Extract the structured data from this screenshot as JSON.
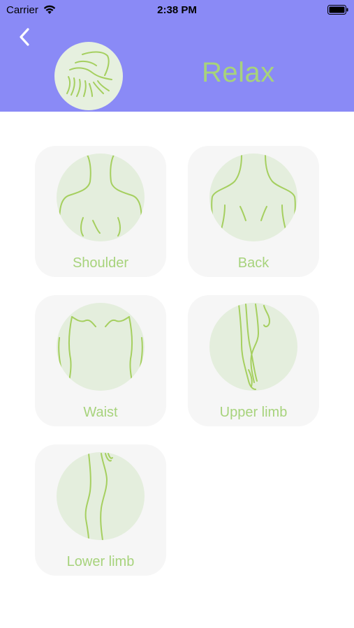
{
  "status_bar": {
    "carrier": "Carrier",
    "time": "2:38 PM"
  },
  "header": {
    "title": "Relax",
    "back_icon": "chevron-left-icon",
    "avatar_icon": "hands-massage-icon",
    "background_color": "#8a8af6",
    "title_color": "#a7d37c"
  },
  "body_parts": [
    {
      "label": "Shoulder",
      "icon": "shoulder-icon"
    },
    {
      "label": "Back",
      "icon": "back-icon"
    },
    {
      "label": "Waist",
      "icon": "waist-icon"
    },
    {
      "label": "Upper limb",
      "icon": "upper-limb-icon"
    },
    {
      "label": "Lower limb",
      "icon": "lower-limb-icon"
    }
  ],
  "colors": {
    "accent_green": "#a7d37c",
    "line_green": "#a5cf5f",
    "card_bg": "#f6f6f6",
    "circle_bg": "#e4eedd"
  }
}
